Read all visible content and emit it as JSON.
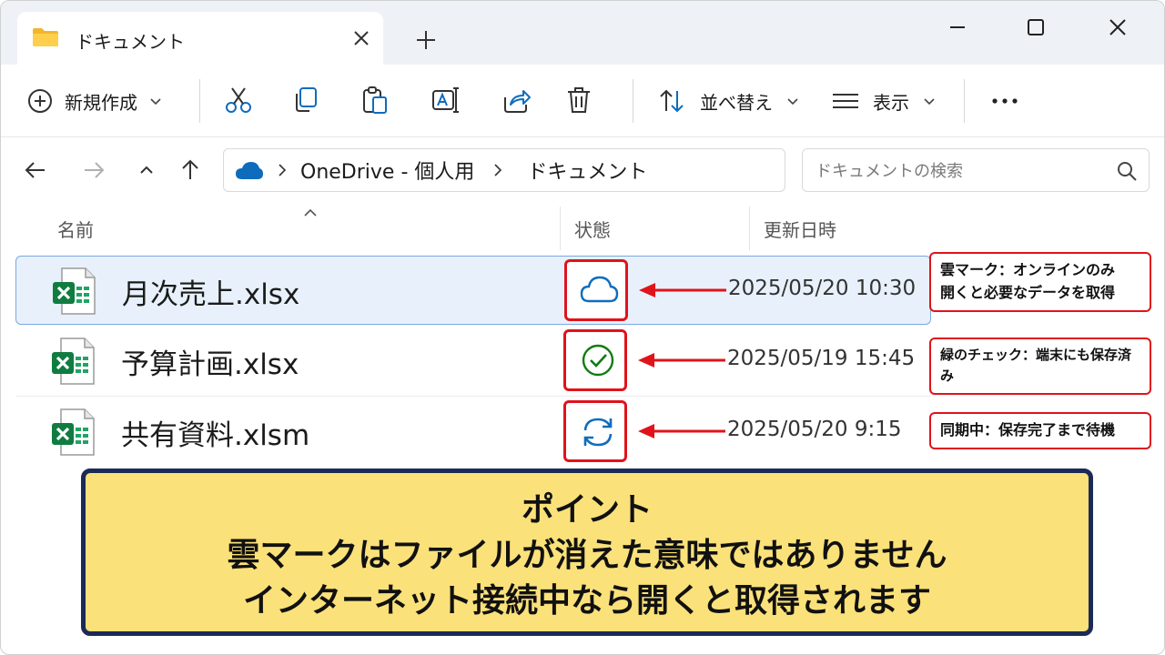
{
  "window": {
    "tab_title": "ドキュメント"
  },
  "commandbar": {
    "new_label": "新規作成",
    "sort_label": "並べ替え",
    "view_label": "表示"
  },
  "address": {
    "crumbs": [
      "OneDrive - 個人用",
      "ドキュメント"
    ]
  },
  "search": {
    "placeholder": "ドキュメントの検索"
  },
  "columns": {
    "name": "名前",
    "status": "状態",
    "modified": "更新日時"
  },
  "files": [
    {
      "name": "月次売上.xlsx",
      "status_icon": "cloud-icon",
      "modified": "2025/05/20 10:30",
      "selected": true
    },
    {
      "name": "予算計画.xlsx",
      "status_icon": "check-circle-icon",
      "modified": "2025/05/19 15:45",
      "selected": false
    },
    {
      "name": "共有資料.xlsm",
      "status_icon": "sync-icon",
      "modified": "2025/05/20 9:15",
      "selected": false
    }
  ],
  "callouts": [
    {
      "line1": "雲マーク：オンラインのみ",
      "line2": "開くと必要なデータを取得"
    },
    {
      "line1": "緑のチェック：端末にも保存済み"
    },
    {
      "line1": "同期中：保存完了まで待機"
    }
  ],
  "point": {
    "heading": "ポイント",
    "line1": "雲マークはファイルが消えた意味ではありません",
    "line2": "インターネット接続中なら開くと取得されます"
  },
  "colors": {
    "accent_red": "#e0131b",
    "cloud_blue": "#0f6cbd",
    "check_green": "#107c10",
    "excel_green": "#107c41",
    "point_bg": "#fbe17a",
    "point_border": "#1c2a57"
  }
}
